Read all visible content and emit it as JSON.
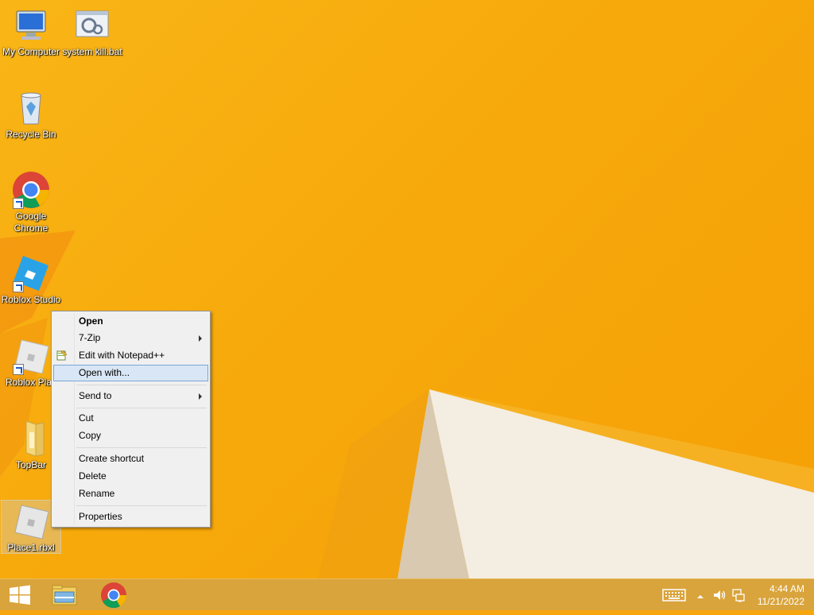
{
  "desktop": {
    "icons": [
      {
        "label": "My Computer",
        "icon": "computer-icon"
      },
      {
        "label": "system kill.bat",
        "icon": "batch-file-icon"
      },
      {
        "label": "Recycle Bin",
        "icon": "recycle-bin-icon"
      },
      {
        "label": "Google Chrome",
        "icon": "chrome-icon"
      },
      {
        "label": "Roblox Studio",
        "icon": "roblox-studio-icon"
      },
      {
        "label": "Roblox Play",
        "icon": "roblox-player-icon"
      },
      {
        "label": "TopBar",
        "icon": "folder-icon"
      },
      {
        "label": "Place1.rbxl",
        "icon": "roblox-file-icon"
      }
    ]
  },
  "context_menu": {
    "items": [
      {
        "label": "Open",
        "bold": true
      },
      {
        "label": "7-Zip",
        "submenu": true
      },
      {
        "label": "Edit with Notepad++",
        "icon": "notepad-plus-plus-icon"
      },
      {
        "label": "Open with...",
        "highlighted": true
      },
      {
        "label": "Send to",
        "submenu": true
      },
      {
        "label": "Cut"
      },
      {
        "label": "Copy"
      },
      {
        "label": "Create shortcut"
      },
      {
        "label": "Delete"
      },
      {
        "label": "Rename"
      },
      {
        "label": "Properties"
      }
    ]
  },
  "taskbar": {
    "start_icon": "windows-logo-icon",
    "pinned": [
      "file-explorer-icon",
      "chrome-icon"
    ],
    "tray": [
      "keyboard-icon",
      "show-hidden-icons-arrow",
      "volume-icon",
      "network-icon"
    ],
    "time": "4:44 AM",
    "date": "11/21/2022"
  },
  "colors": {
    "wallpaper": "#f7a90b",
    "menu_highlight": "#d9e6f5",
    "menu_highlight_border": "#7aa7d8"
  }
}
